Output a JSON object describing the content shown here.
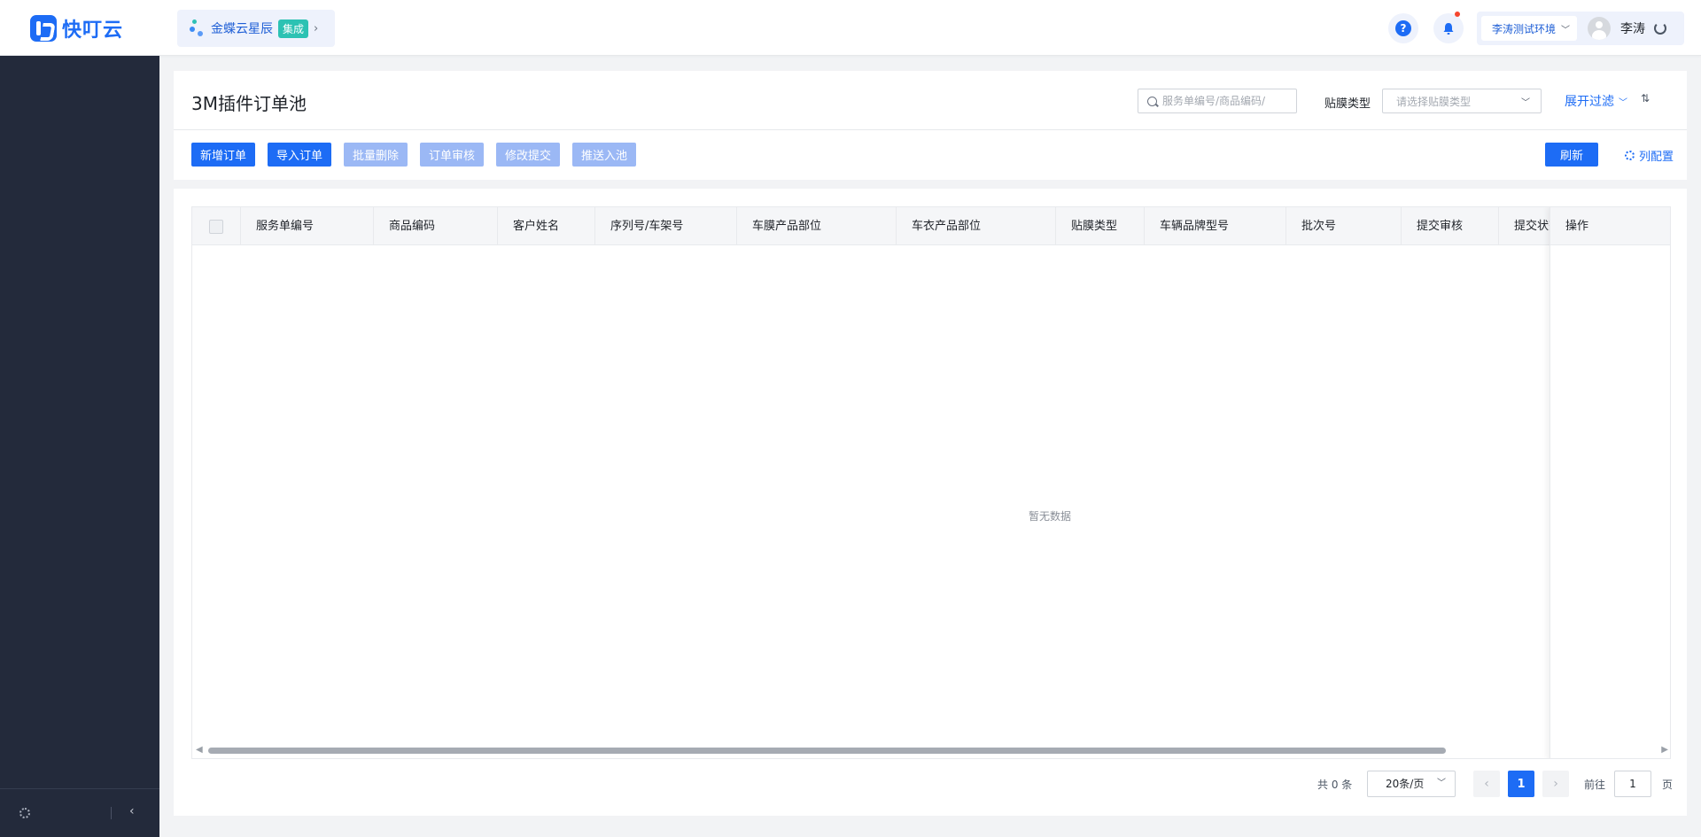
{
  "header": {
    "logo_text": "快叮云",
    "app_switch": {
      "name": "金蝶云星辰",
      "badge": "集成"
    },
    "help_label": "?",
    "environment": "李涛测试环境",
    "user_name": "李涛"
  },
  "page": {
    "title": "3M插件订单池",
    "search_placeholder": "服务单编号/商品编码/",
    "filter_label": "贴膜类型",
    "filter_placeholder": "请选择贴膜类型",
    "expand_filter": "展开过滤",
    "sort_icon": "⇅"
  },
  "toolbar": {
    "add_order": "新增订单",
    "import_order": "导入订单",
    "batch_delete": "批量删除",
    "order_review": "订单审核",
    "modify_submit": "修改提交",
    "push_pool": "推送入池",
    "refresh": "刷新",
    "column_config": "列配置"
  },
  "table": {
    "columns": [
      "服务单编号",
      "商品编码",
      "客户姓名",
      "序列号/车架号",
      "车膜产品部位",
      "车衣产品部位",
      "贴膜类型",
      "车辆品牌型号",
      "批次号",
      "提交审核",
      "提交状态"
    ],
    "fixed_column": "操作",
    "empty_text": "暂无数据"
  },
  "pagination": {
    "total": "共 0 条",
    "page_size": "20条/页",
    "current_page": "1",
    "goto_label": "前往",
    "goto_value": "1",
    "page_unit": "页"
  },
  "colors": {
    "primary": "#1d6cf5",
    "disabled": "#9bb8f5",
    "sidebar": "#232a3b",
    "badge": "#2cc2b3",
    "notification_dot": "#f5452d"
  }
}
